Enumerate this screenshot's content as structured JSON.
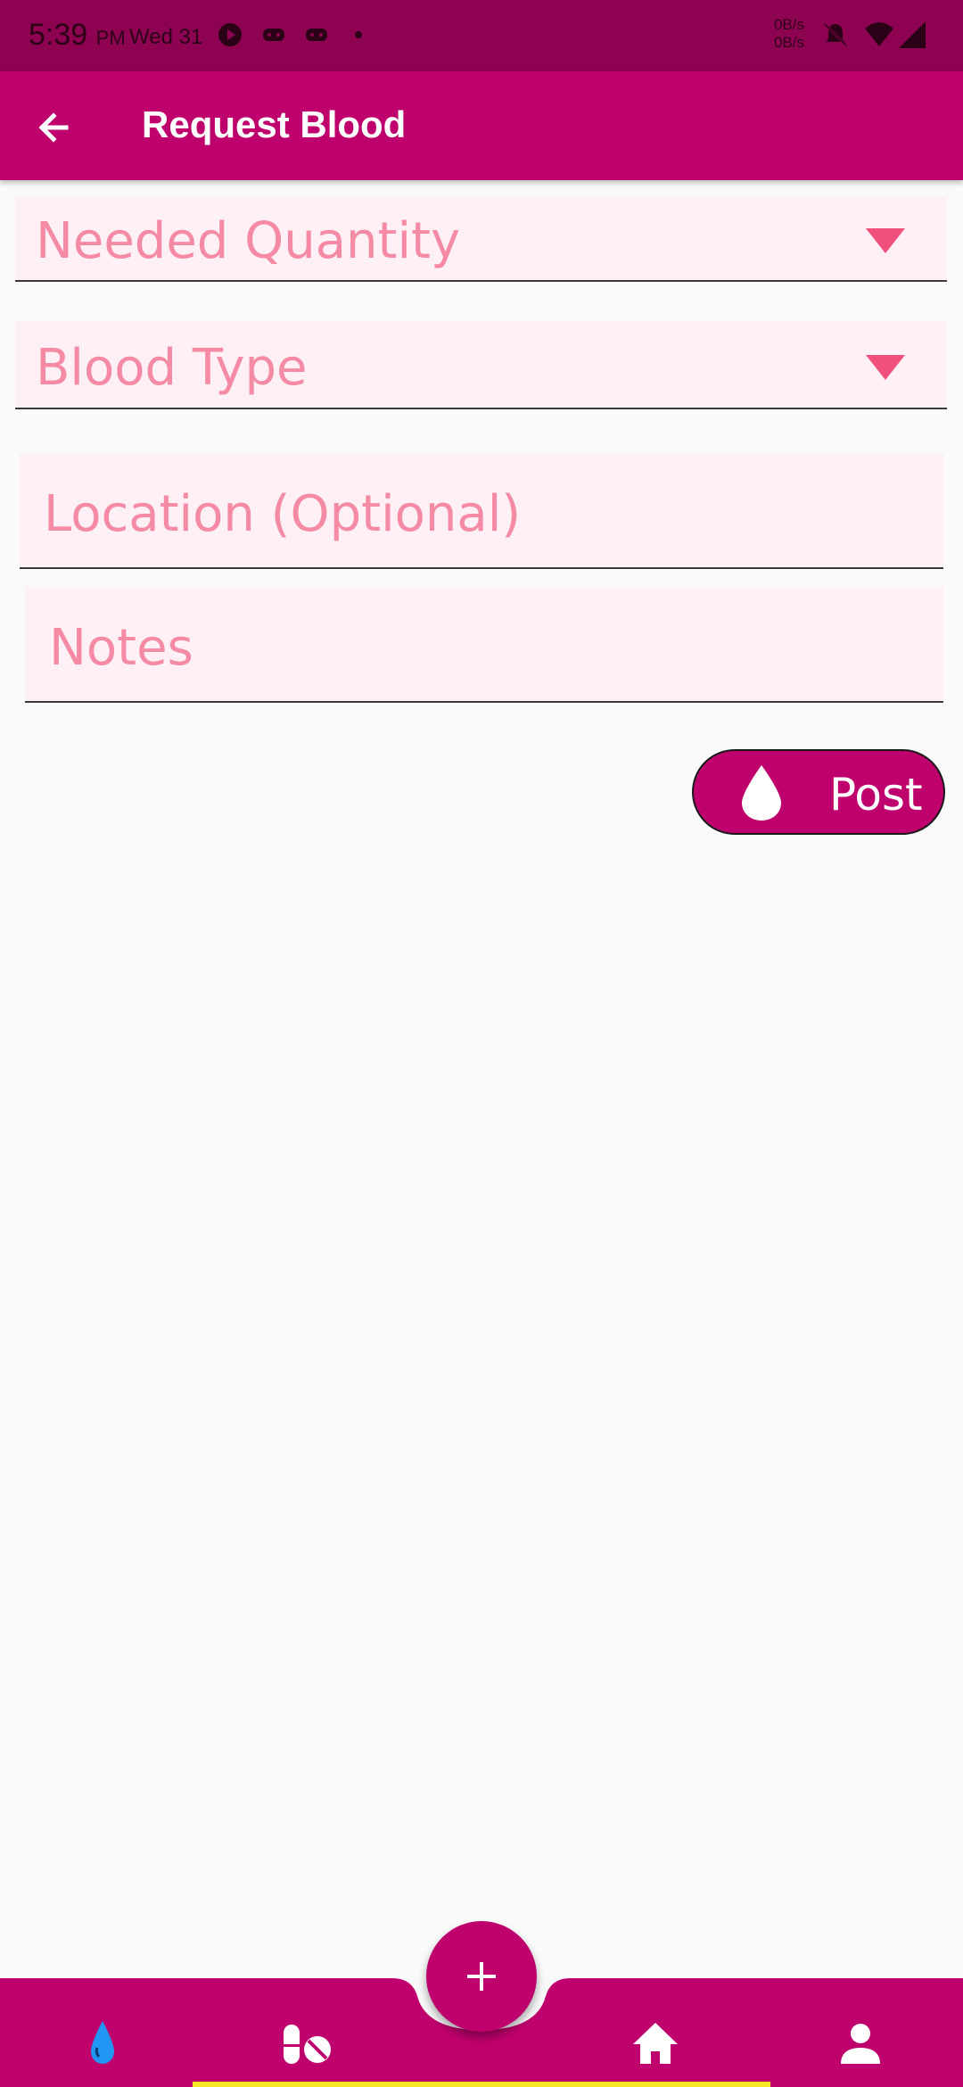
{
  "status_bar": {
    "time": "5:39",
    "ampm": "PM",
    "date": "Wed 31",
    "speed_up": "0B/s",
    "speed_down": "0B/s"
  },
  "app_bar": {
    "title": "Request Blood",
    "back_icon": "arrow-back-icon"
  },
  "form": {
    "quantity_label": "Needed Quantity",
    "blood_type_label": "Blood Type",
    "location_placeholder": "Location (Optional)",
    "notes_placeholder": "Notes",
    "post_label": "Post"
  },
  "bottom_nav": {
    "items": [
      "blood-drop-icon",
      "pills-icon",
      "home-icon",
      "person-icon"
    ],
    "fab_icon": "plus-icon"
  },
  "colors": {
    "primary": "#bf016d",
    "status_bar": "#8e0252",
    "field_fill": "#fff0f6",
    "label": "#f48aa3",
    "dropdown_arrow": "#f0507c",
    "active_nav": "#2196f3",
    "indicator": "#f7e623"
  }
}
